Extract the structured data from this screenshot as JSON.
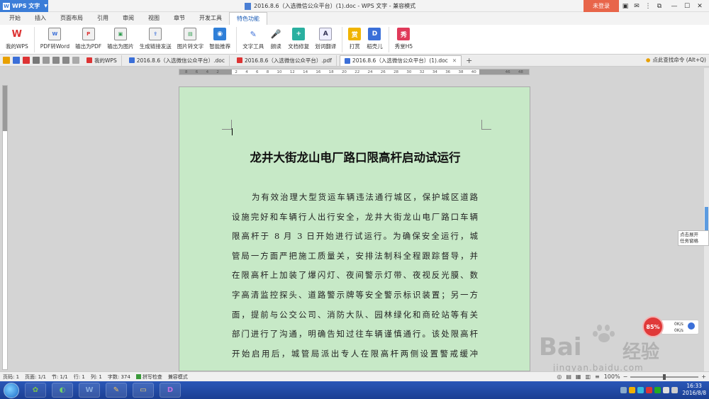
{
  "titlebar": {
    "app_label": "WPS 文字",
    "doc_title": "2016.8.6（入选微信公众平台）(1).doc - WPS 文字 - 兼容模式",
    "login_label": "未登录"
  },
  "ribbon_tabs": [
    "开始",
    "插入",
    "页面布局",
    "引用",
    "审阅",
    "视图",
    "章节",
    "开发工具",
    "特色功能"
  ],
  "active_ribbon_tab": "特色功能",
  "toolbar": {
    "my_wps": "我的WPS",
    "pdf_to_word": "PDF转Word",
    "export_pdf": "输出为PDF",
    "export_image": "输出为图片",
    "share_link": "生成链接发送",
    "image_to_text": "图片转文字",
    "smart_recommend": "智能推荐",
    "text_tools": "文字工具",
    "read_aloud": "朗读",
    "doc_repair": "文档修复",
    "translate": "划词翻译",
    "reward": "打赏",
    "shell": "稻壳儿",
    "show_h5": "秀堂H5"
  },
  "doc_tabs": [
    {
      "label": "我的WPS",
      "active": false
    },
    {
      "label": "2016.8.6（入选微信公众平台）.doc",
      "active": false
    },
    {
      "label": "2016.8.6（入选微信公众平台）.pdf",
      "active": false
    },
    {
      "label": "2016.8.6（入选微信公众平台）(1).doc",
      "active": true
    }
  ],
  "find_command": "点此查找命令 (Alt+Q)",
  "ruler_labels": [
    "8",
    "6",
    "4",
    "2",
    "",
    "2",
    "4",
    "6",
    "8",
    "10",
    "12",
    "14",
    "16",
    "18",
    "20",
    "22",
    "24",
    "26",
    "28",
    "30",
    "32",
    "34",
    "36",
    "38",
    "40",
    "42",
    "",
    "46",
    "48"
  ],
  "document": {
    "heading": "龙井大街龙山电厂路口限高杆启动试运行",
    "lines": [
      "为有效治理大型货运车辆违法通行城区，保护城区道路",
      "设施完好和车辆行人出行安全，龙井大街龙山电厂路口车辆",
      "限高杆于 8 月 3 日开始进行试运行。为确保安全运行，城",
      "管局一方面严把施工质量关，安排法制科全程跟踪督导，并",
      "在限高杆上加装了爆闪灯、夜间警示灯带、夜视反光膜、数",
      "字高清监控探头、道路警示牌等安全警示标识装置；另一方",
      "面，提前与公交公司、消防大队、园林绿化和商砼站等有关",
      "部门进行了沟通，明确告知过往车辆谨慎通行。该处限高杆",
      "开始启用后，城管局派出专人在限高杆两侧设置警戒缓冲"
    ]
  },
  "task_pane_tip": [
    "点击展开",
    "任务窗格"
  ],
  "net_widget": {
    "percent": "85%",
    "up": "0K/s",
    "down": "0K/s"
  },
  "watermark": {
    "brand": "Bai",
    "brand2": "经验",
    "url": "jingyan.baidu.com"
  },
  "statusbar": {
    "page": "页码: 1",
    "pages": "页面: 1/1",
    "section": "节: 1/1",
    "row": "行: 1",
    "col": "列: 1",
    "words": "字数: 374",
    "spell": "拼写检查",
    "compat": "兼容模式",
    "zoom": "100%"
  },
  "taskbar": {
    "time": "16:33",
    "date": "2016/8/8"
  },
  "colors": {
    "accent": "#3b7dd8",
    "page_bg": "#c7e9c7",
    "login": "#e8654a"
  }
}
